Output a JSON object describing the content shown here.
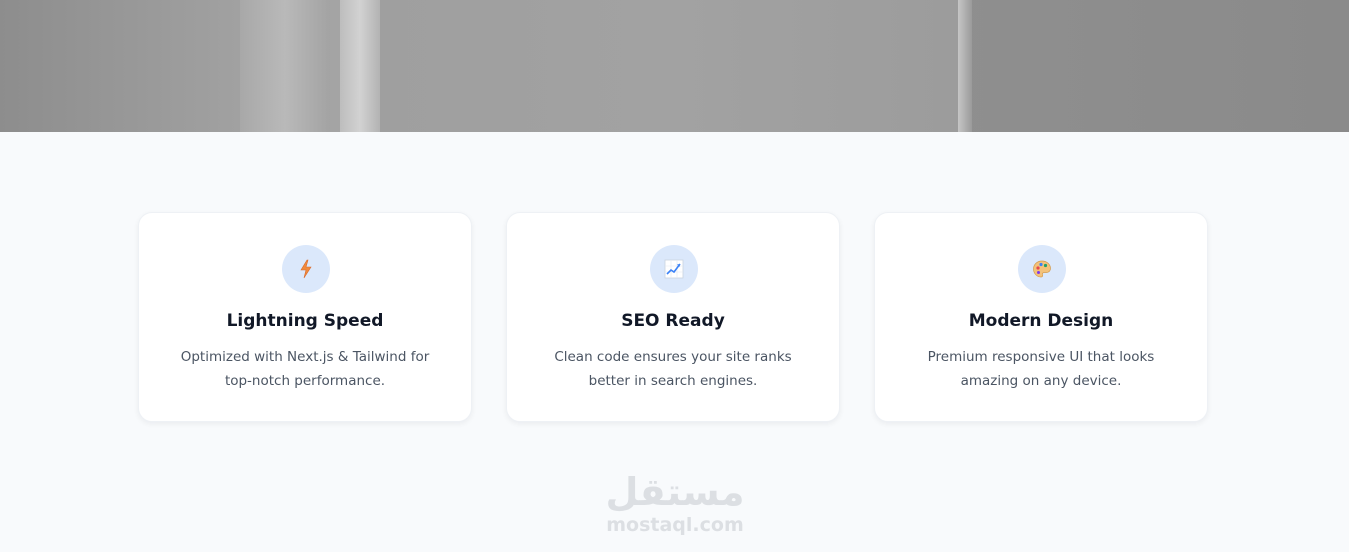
{
  "features": [
    {
      "icon": "lightning-icon",
      "title": "Lightning Speed",
      "description": "Optimized with Next.js & Tailwind for top-notch performance."
    },
    {
      "icon": "chart-icon",
      "title": "SEO Ready",
      "description": "Clean code ensures your site ranks better in search engines."
    },
    {
      "icon": "palette-icon",
      "title": "Modern Design",
      "description": "Premium responsive UI that looks amazing on any device."
    }
  ],
  "watermark": {
    "arabic": "مستقل",
    "latin": "mostaql.com"
  },
  "colors": {
    "icon_bg": "#dbe8fb",
    "title": "#111827",
    "text": "#4b5563",
    "page_bg": "#f8fafc"
  }
}
